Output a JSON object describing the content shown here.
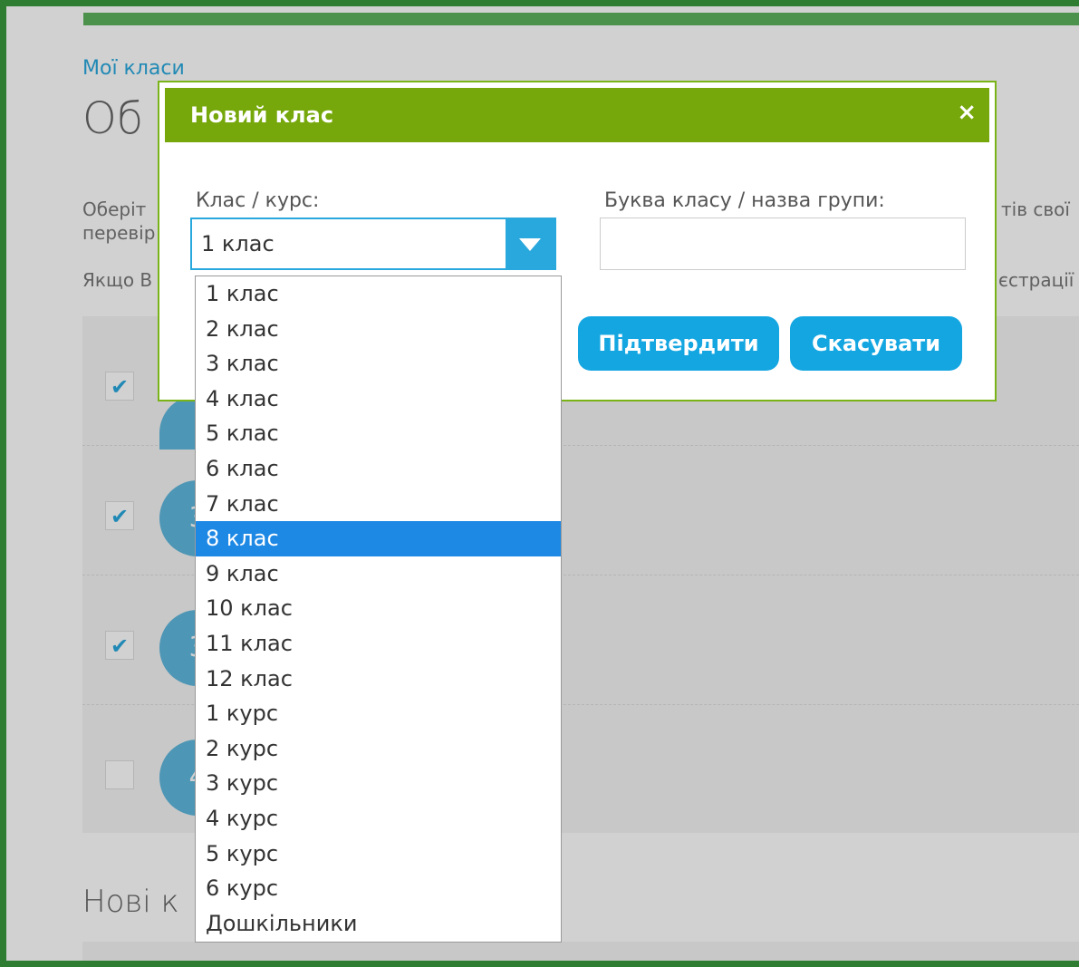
{
  "page": {
    "breadcrumb": "Мої класи",
    "title_fragment": "Об",
    "desc_fragments": [
      "Оберіт",
      "перевір",
      "Якщо В",
      "тів свої",
      "єстрації"
    ],
    "class_avatars": [
      "",
      "3",
      "3",
      "4"
    ],
    "class_checked": [
      true,
      true,
      true,
      false
    ],
    "new_classes_title_fragment": "Нові к"
  },
  "modal": {
    "title": "Новий клас",
    "close_symbol": "×",
    "class_label": "Клас / курс:",
    "selected_value": "1 клас",
    "letter_label": "Буква класу / назва групи:",
    "letter_value": "",
    "confirm_label": "Підтвердити",
    "cancel_label": "Скасувати"
  },
  "dropdown": {
    "highlighted": "8 клас",
    "options": [
      "1 клас",
      "2 клас",
      "3 клас",
      "4 клас",
      "5 клас",
      "6 клас",
      "7 клас",
      "8 клас",
      "9 клас",
      "10 клас",
      "11 клас",
      "12 клас",
      "1 курс",
      "2 курс",
      "3 курс",
      "4 курс",
      "5 курс",
      "6 курс",
      "Дошкільники"
    ]
  },
  "colors": {
    "modal_header": "#76a80c",
    "accent_blue": "#29a8dd",
    "highlight": "#1e88e5",
    "frame_border": "#2f7d32"
  }
}
